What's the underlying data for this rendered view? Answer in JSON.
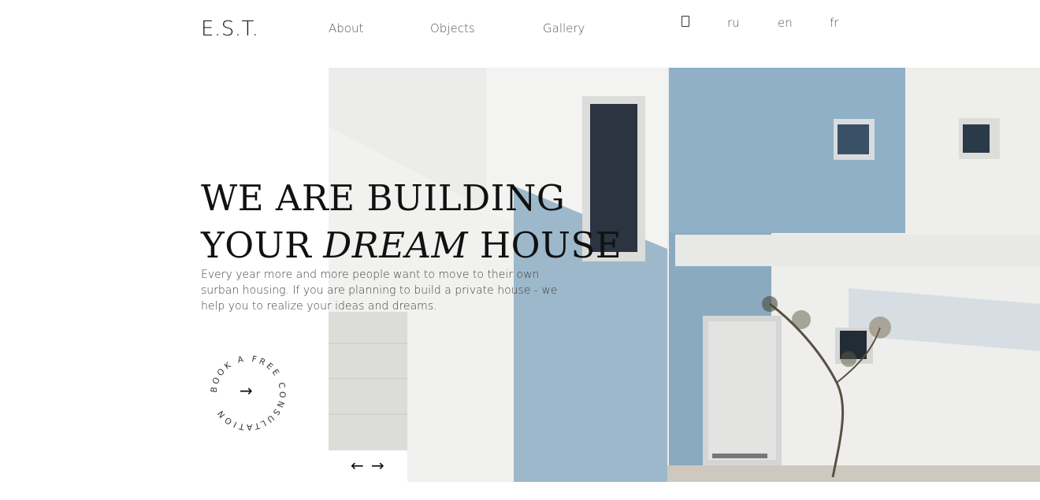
{
  "header": {
    "logo": "E.S.T.",
    "nav": [
      {
        "label": "About"
      },
      {
        "label": "Objects"
      },
      {
        "label": "Gallery"
      }
    ],
    "languages": [
      "ru",
      "en",
      "fr"
    ],
    "language_icon": "phone-icon"
  },
  "hero": {
    "headline_line1": "WE ARE BUILDING",
    "headline_line2_a": "YOUR ",
    "headline_line2_em": "DREAM",
    "headline_line2_b": " HOUSE",
    "subtext": "Every year more and more people want to move to their own surban housing. If you are planning to build a private house - we help you to realize your ideas and dreams.",
    "cta_label": "BOOK A FREE CONSULTATION",
    "cta_arrow": "→",
    "prev_arrow": "←",
    "next_arrow": "→"
  },
  "colors": {
    "wall_blue": "#8fb0c6",
    "wall_white": "#efefec",
    "text_dark": "#111111"
  }
}
